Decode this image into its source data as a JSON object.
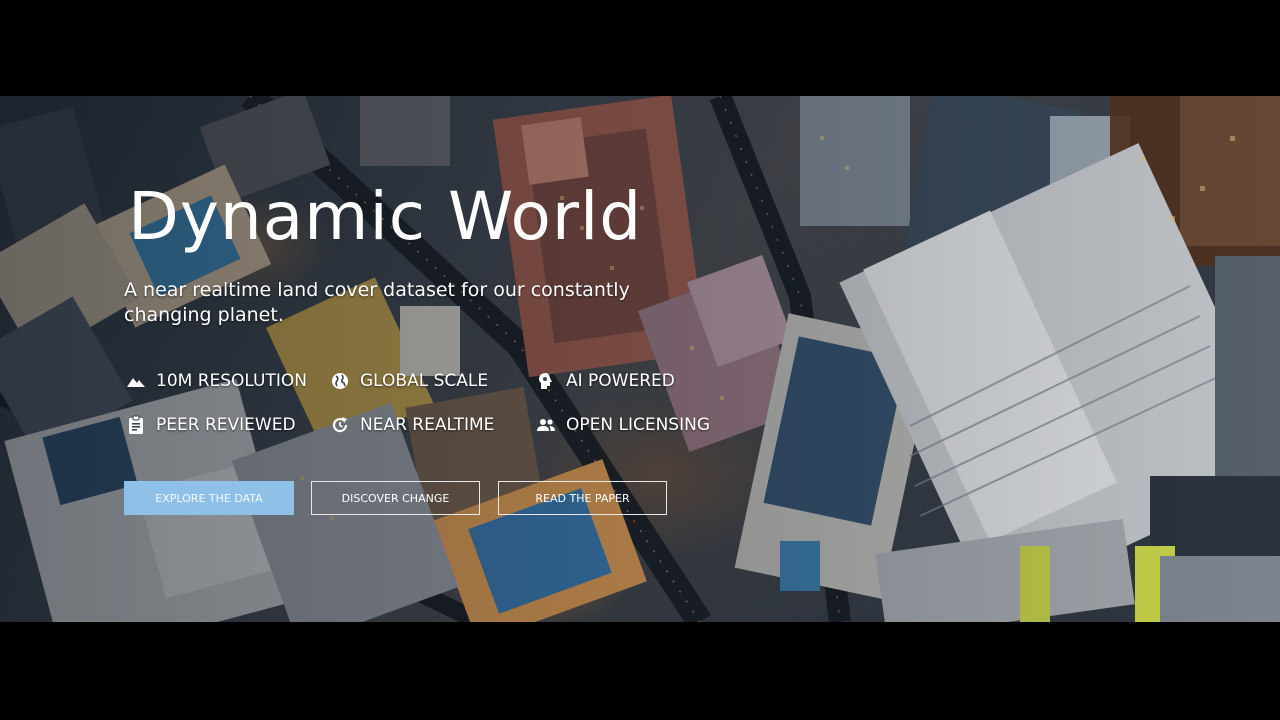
{
  "hero": {
    "title": "Dynamic World",
    "subtitle": "A near realtime land cover dataset for our constantly changing planet."
  },
  "features": [
    {
      "icon": "landscape-icon",
      "label": "10M RESOLUTION"
    },
    {
      "icon": "globe-icon",
      "label": "GLOBAL SCALE"
    },
    {
      "icon": "head-brain-icon",
      "label": "AI POWERED"
    },
    {
      "icon": "clipboard-icon",
      "label": "PEER REVIEWED"
    },
    {
      "icon": "refresh-icon",
      "label": "NEAR REALTIME"
    },
    {
      "icon": "people-icon",
      "label": "OPEN LICENSING"
    }
  ],
  "buttons": {
    "explore": "EXPLORE THE DATA",
    "discover": "DISCOVER CHANGE",
    "paper": "READ THE PAPER"
  },
  "colors": {
    "primary_button": "#8fc0e8",
    "text": "#ffffff",
    "letterbox": "#000000"
  }
}
